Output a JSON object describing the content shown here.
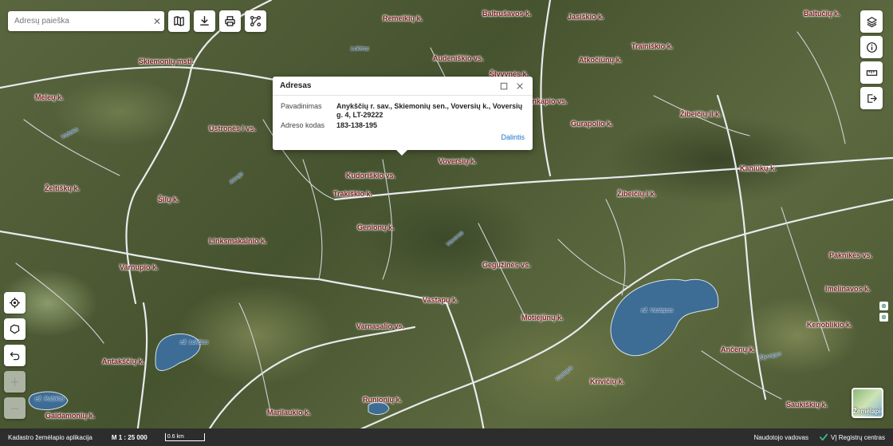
{
  "search": {
    "placeholder": "Adresų paieška"
  },
  "toolbar": {
    "icons": [
      "map-icon",
      "download-icon",
      "print-icon",
      "route-icon"
    ]
  },
  "popup": {
    "title": "Adresas",
    "rows": [
      {
        "key": "Pavadinimas",
        "value": "Anykščių r. sav., Skiemonių sen., Voversių k., Voversių g. 4, LT-29222"
      },
      {
        "key": "Adreso kodas",
        "value": "183-138-195"
      }
    ],
    "share_label": "Dalintis"
  },
  "places": [
    "Remeikių k.",
    "Baltrušavos k.",
    "Jasiškio k.",
    "Baltučių k.",
    "Skiemonių mstl.",
    "Audeniškio vs.",
    "Atkočiūnų k.",
    "Trainiškio k.",
    "Meleų k.",
    "Ustronės I vs.",
    "Šlyvynės k.",
    "Milankapio vs.",
    "Gurapolio k.",
    "Žibeičių II k.",
    "Kudoriškio vs.",
    "Voversių k.",
    "Kaniūkų k.",
    "Želtiškų k.",
    "Šilų k.",
    "Trakiškio k.",
    "Žibeičių I k.",
    "Genionų k.",
    "Linksmakalnio k.",
    "Varnupio k.",
    "Paknikės vs.",
    "Gegužinės vs.",
    "Vastapų k.",
    "Imelinavos k.",
    "Kerioblikio k.",
    "Varnasalio vs.",
    "Motiejūnų k.",
    "Antakščių k.",
    "Ančenų k.",
    "Krivičių k.",
    "Runionių k.",
    "Marilaukio k.",
    "Gaidamonių k.",
    "Saukiškių k."
  ],
  "waters": [
    "Lokėsa",
    "Vašaka",
    "Kinoja",
    "Voversa",
    "ež. Lukštas",
    "ež. Vastapas",
    "Vastapa",
    "ež. Rubikiai",
    "Šlyvapys"
  ],
  "right_controls": [
    "layers-icon",
    "info-icon",
    "ruler-icon",
    "logout-icon"
  ],
  "left_controls": [
    "locate-icon",
    "area-icon",
    "undo-icon",
    "zoom-in-icon",
    "zoom-out-icon"
  ],
  "basemap": {
    "label": "Žemėlapis"
  },
  "footer": {
    "app_name": "Kadastro žemėlapio aplikacija",
    "scale": "M 1 : 25 000",
    "scale_bar": "0.6 km",
    "guide": "Naudotojo vadovas",
    "registry": "VĮ Registrų centras"
  },
  "colors": {
    "accent": "#1a73c9",
    "footer_bg": "#2d2d2d",
    "place_label": "#7a1a1a",
    "water": "#3d6c94"
  }
}
